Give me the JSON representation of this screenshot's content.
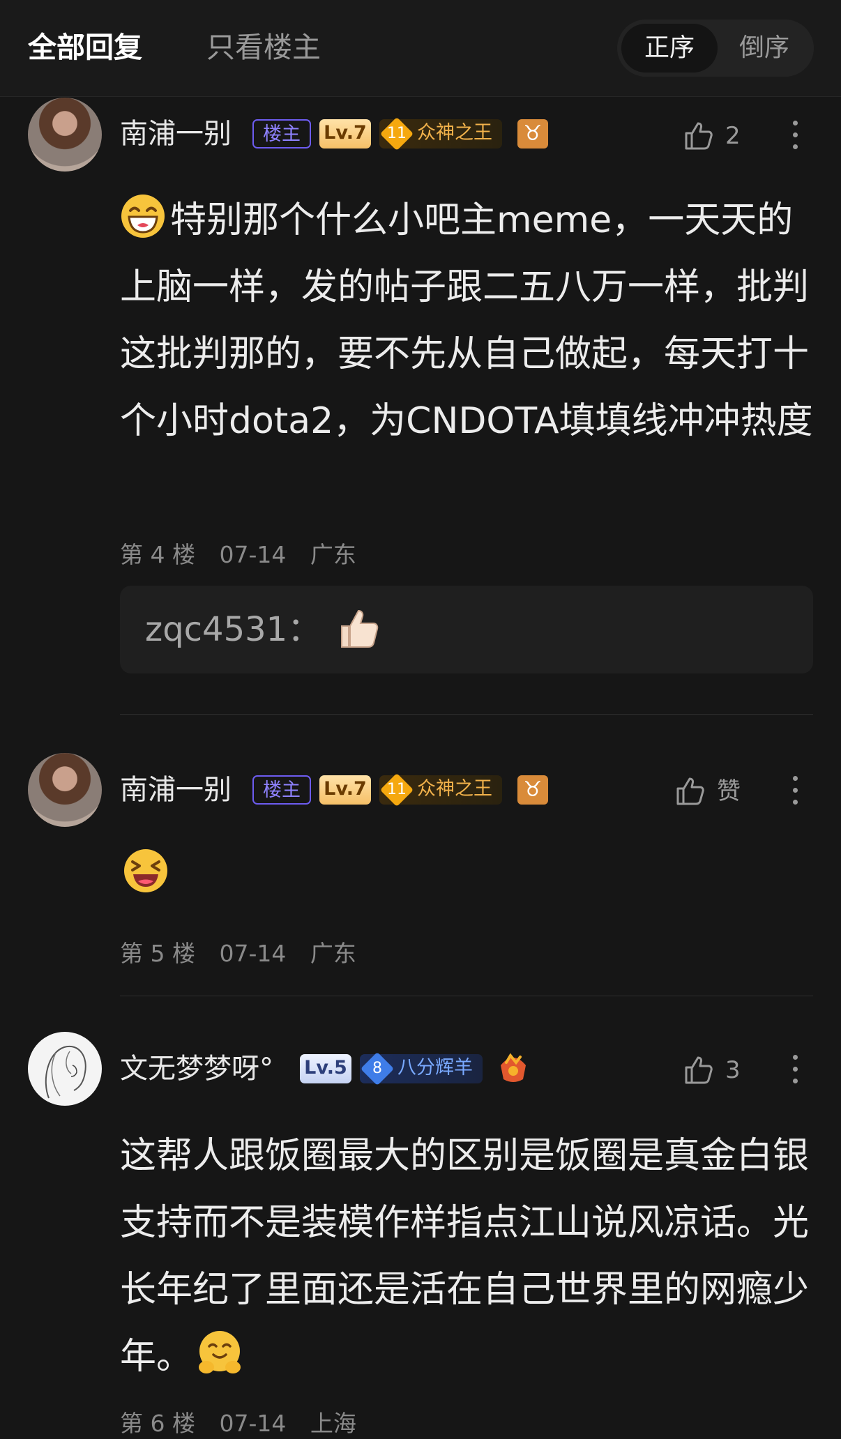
{
  "header": {
    "tab_all": "全部回复",
    "tab_host": "只看楼主",
    "sort_asc": "正序",
    "sort_desc": "倒序"
  },
  "posts": [
    {
      "username": "南浦一别",
      "host_badge": "楼主",
      "level": "Lv.7",
      "title_level": "11",
      "title": "众神之王",
      "zodiac": "♉",
      "likes": "2",
      "content": "特别那个什么小吧主meme，一天天的上脑一样，发的帖子跟二五八万一样，批判这批判那的，要不先从自己做起，每天打十个小时dota2，为CNDOTA填填线冲冲热度",
      "floor": "第 4 楼",
      "date": "07-14",
      "location": "广东",
      "reply": {
        "name": "zqc4531：",
        "emoji": "thumbs-up"
      }
    },
    {
      "username": "南浦一别",
      "host_badge": "楼主",
      "level": "Lv.7",
      "title_level": "11",
      "title": "众神之王",
      "zodiac": "♉",
      "likes": "赞",
      "content": "",
      "floor": "第 5 楼",
      "date": "07-14",
      "location": "广东"
    },
    {
      "username": "文无梦梦呀°",
      "level": "Lv.5",
      "title_level": "8",
      "title": "八分辉羊",
      "likes": "3",
      "content": "这帮人跟饭圈最大的区别是饭圈是真金白银支持而不是装模作样指点江山说风凉话。光长年纪了里面还是活在自己世界里的网瘾少年。",
      "floor": "第 6 楼",
      "date": "07-14",
      "location": "上海"
    }
  ],
  "colors": {
    "background": "#161616",
    "host_badge": "#6d5cf0",
    "title_gold": "#f2b24b",
    "title_blue": "#79a9ff"
  }
}
